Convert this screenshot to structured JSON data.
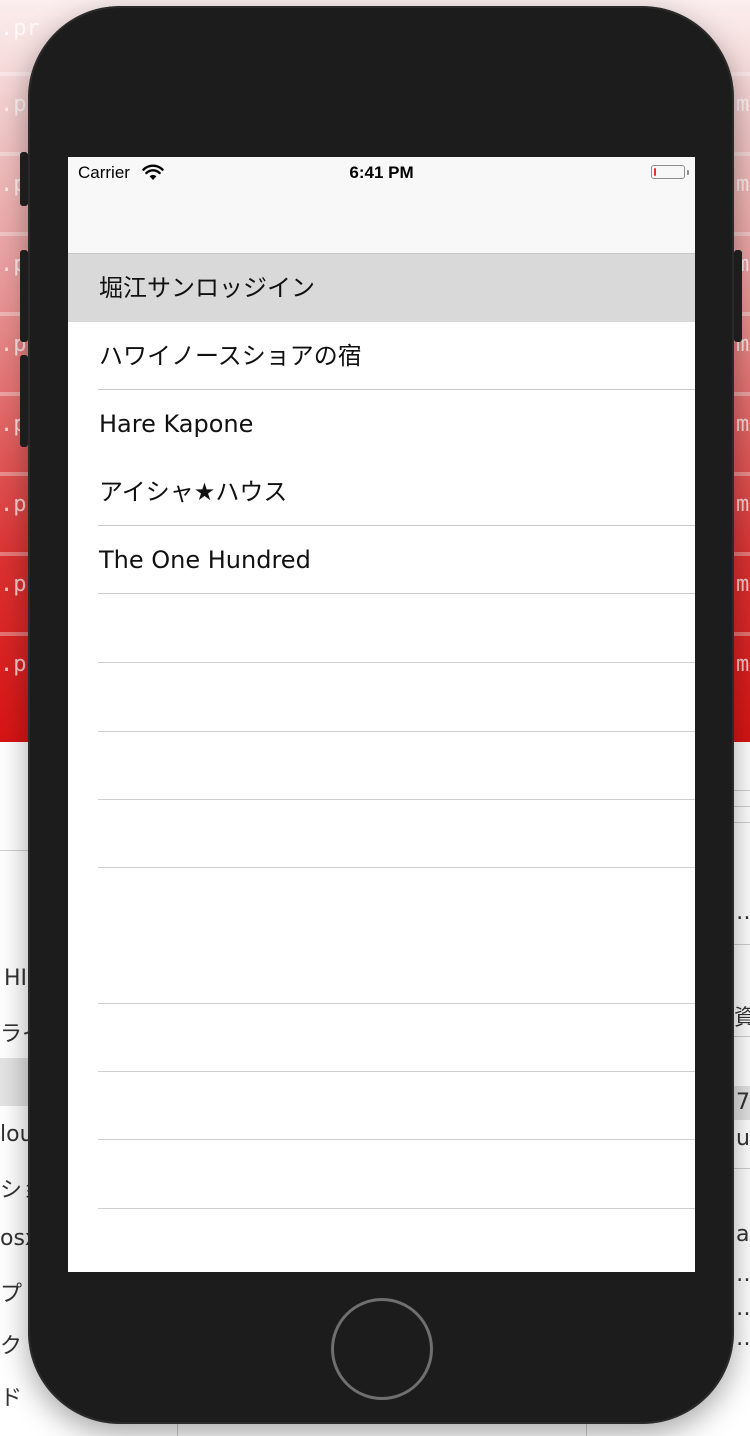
{
  "status_bar": {
    "carrier": "Carrier",
    "time": "6:41 PM",
    "battery_level": 0.08,
    "battery_color": "#e33232"
  },
  "hotel_list": {
    "items": [
      {
        "label": "堀江サンロッジイン",
        "selected": true
      },
      {
        "label": "ハワイノースショアの宿",
        "selected": false
      },
      {
        "label": "Hare Kapone",
        "selected": false
      },
      {
        "label": "アイシャ★ハウス",
        "selected": false
      },
      {
        "label": "The One Hundred",
        "selected": false
      }
    ]
  },
  "background_fragments": {
    "left_mono": ".pr",
    "right_mono": "m",
    "left_texts": [
      "HI",
      "ライ",
      "lou",
      "ショ",
      "osx",
      "プ",
      "ク",
      "ド"
    ],
    "right_texts": [
      "…",
      "資",
      "7",
      "u",
      "as",
      "…",
      "…",
      "…"
    ]
  },
  "colors": {
    "device_body": "#1c1c1c",
    "selection": "#d9d9d9",
    "separator": "#c8c8c8"
  }
}
